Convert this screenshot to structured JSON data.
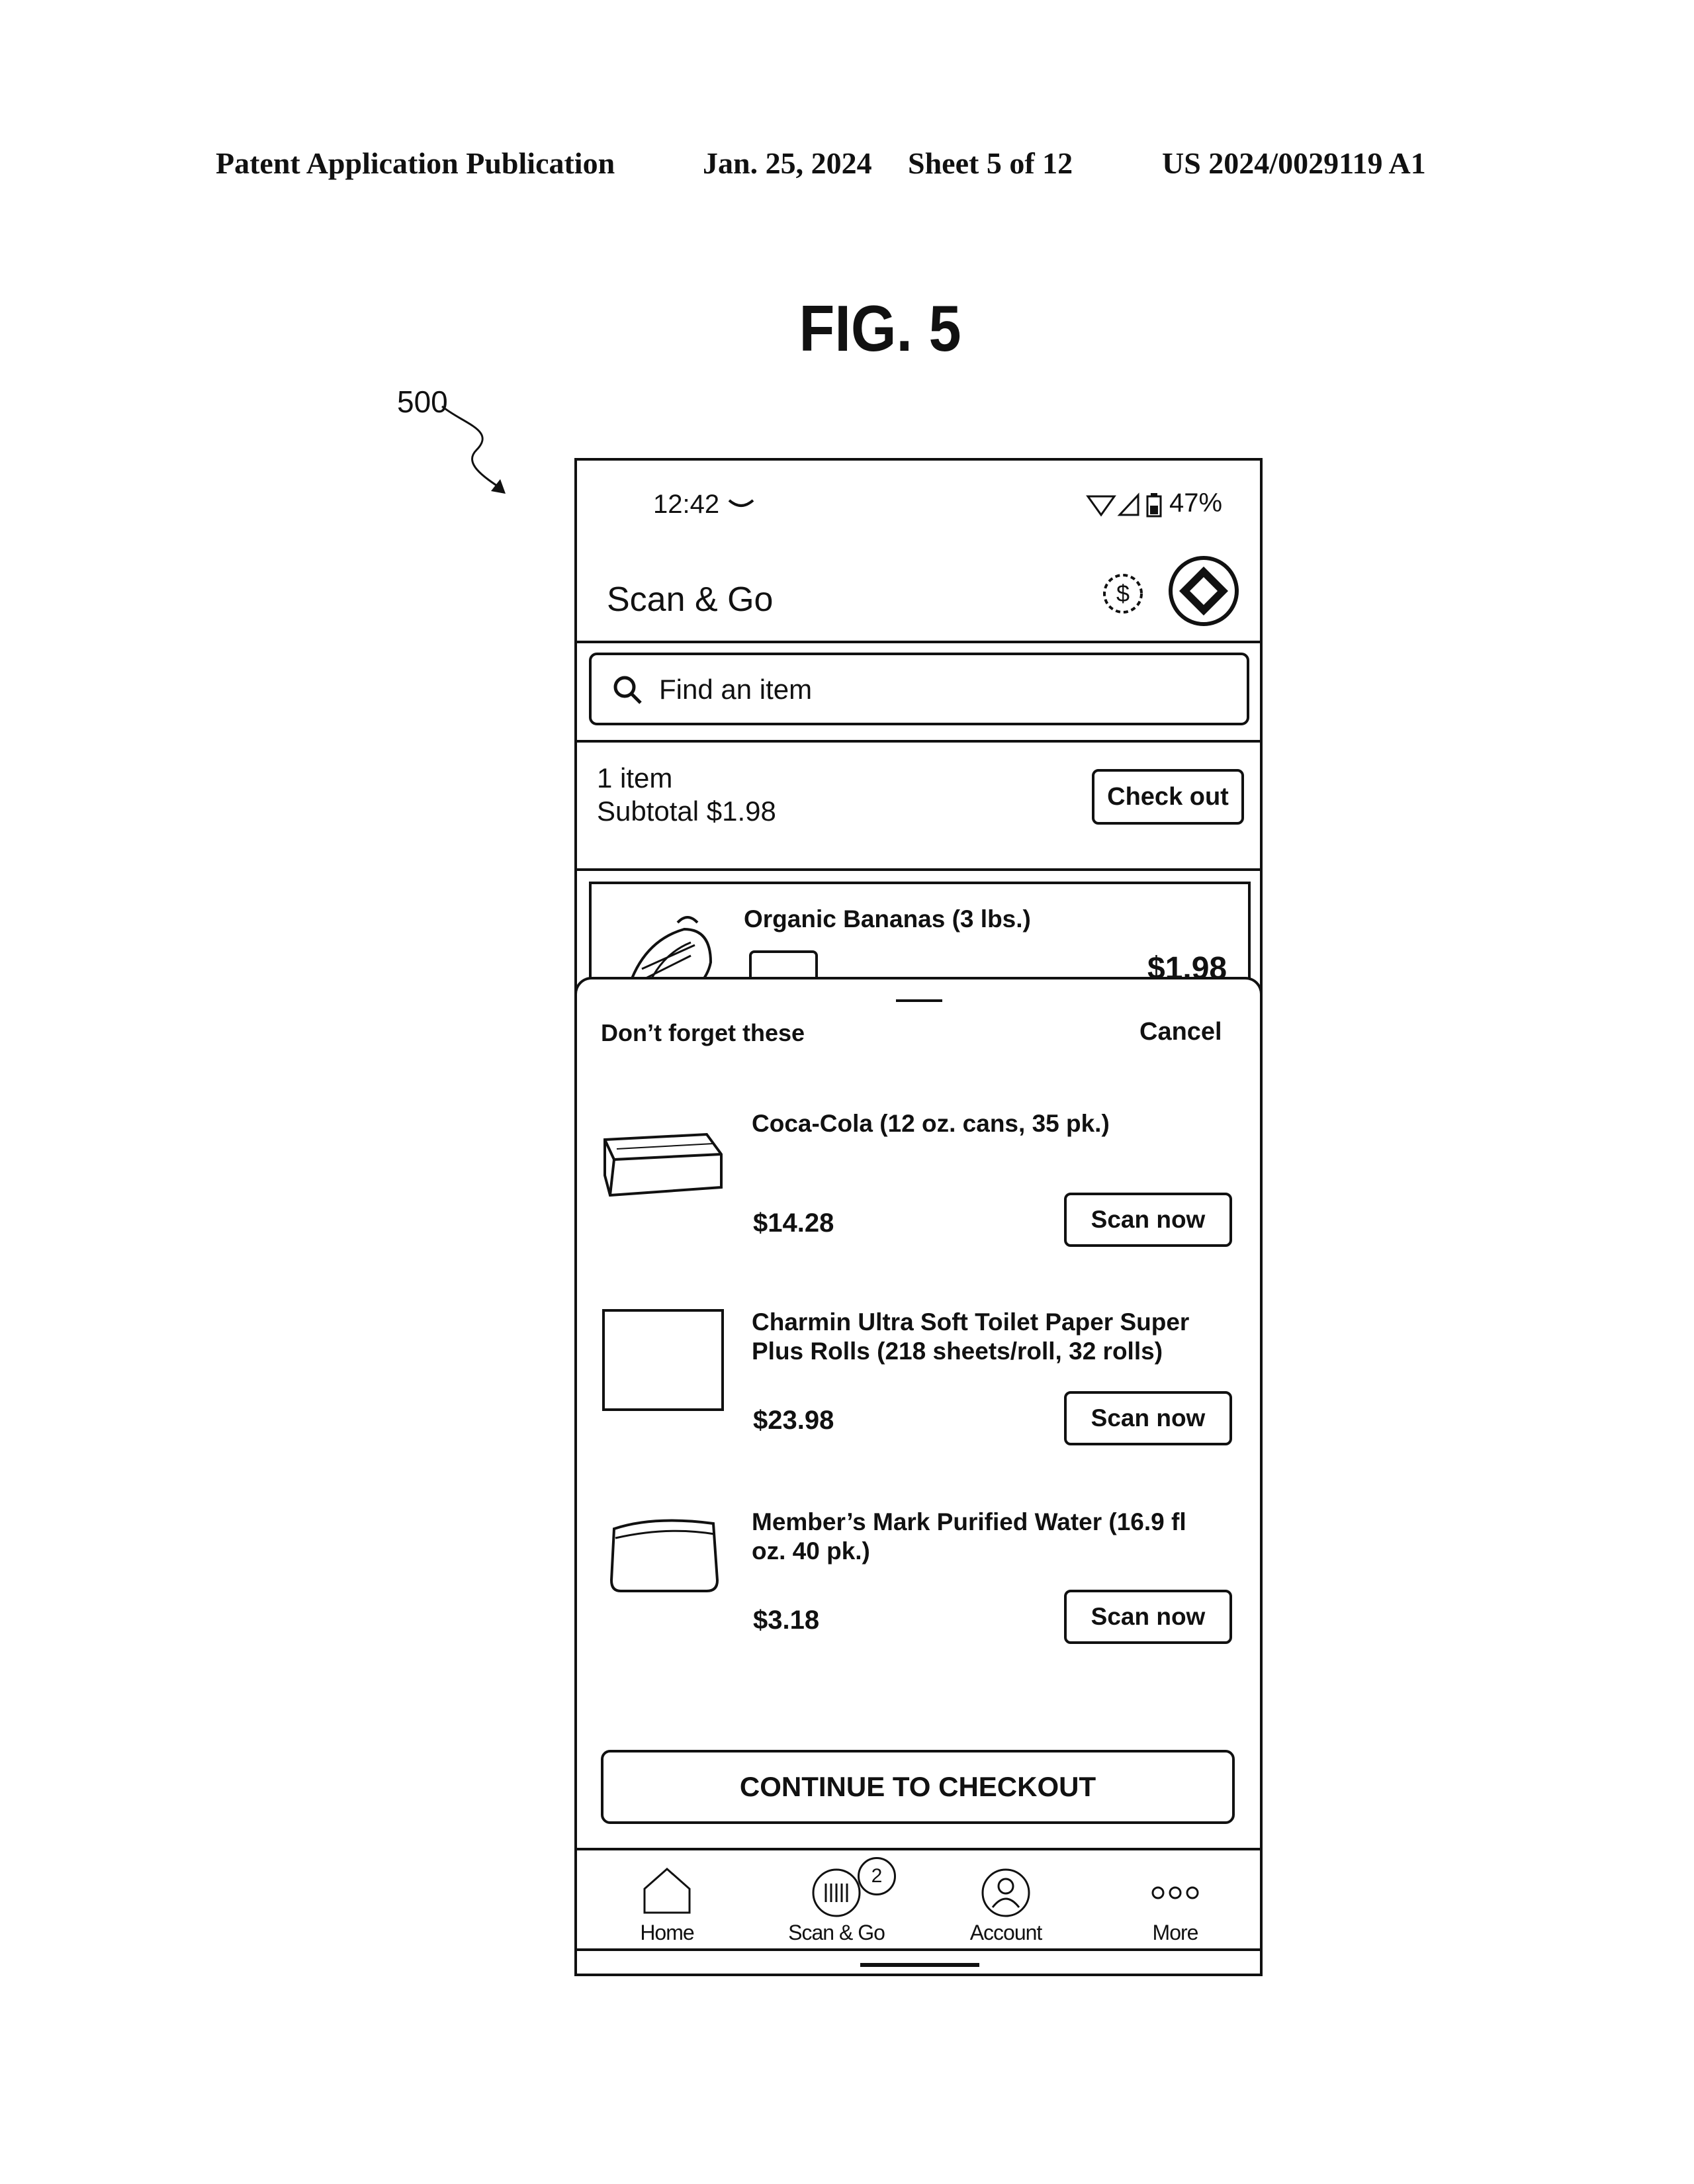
{
  "document": {
    "header_left": "Patent Application Publication",
    "header_date": "Jan. 25, 2024",
    "header_sheet": "Sheet 5 of 12",
    "header_number": "US 2024/0029119 A1",
    "figure_title": "FIG. 5",
    "reference_number": "500"
  },
  "status_bar": {
    "time": "12:42",
    "battery": "47%"
  },
  "app_bar": {
    "title": "Scan & Go",
    "icons": [
      "dollar-circle-icon",
      "brand-diamond-icon"
    ]
  },
  "search": {
    "placeholder": "Find an item"
  },
  "cart_summary": {
    "item_count": "1 item",
    "subtotal": "Subtotal $1.98",
    "checkout_label": "Check out"
  },
  "cart_items": [
    {
      "name": "Organic Bananas (3 lbs.)",
      "price": "$1.98"
    }
  ],
  "suggestions_sheet": {
    "title": "Don’t forget these",
    "cancel_label": "Cancel",
    "items": [
      {
        "name": "Coca-Cola (12 oz. cans, 35 pk.)",
        "price": "$14.28",
        "action": "Scan now",
        "icon": "box-icon"
      },
      {
        "name": "Charmin Ultra Soft Toilet Paper Super Plus Rolls (218 sheets/roll, 32 rolls)",
        "price": "$23.98",
        "action": "Scan now",
        "icon": "image-placeholder-icon"
      },
      {
        "name": "Member’s Mark Purified Water (16.9 fl oz. 40 pk.)",
        "price": "$3.18",
        "action": "Scan now",
        "icon": "water-pack-icon"
      }
    ],
    "continue_label": "CONTINUE TO CHECKOUT"
  },
  "bottom_nav": {
    "items": [
      {
        "label": "Home",
        "icon": "home-icon"
      },
      {
        "label": "Scan & Go",
        "icon": "barcode-scan-icon",
        "badge": "2"
      },
      {
        "label": "Account",
        "icon": "account-icon"
      },
      {
        "label": "More",
        "icon": "more-icon"
      }
    ]
  }
}
